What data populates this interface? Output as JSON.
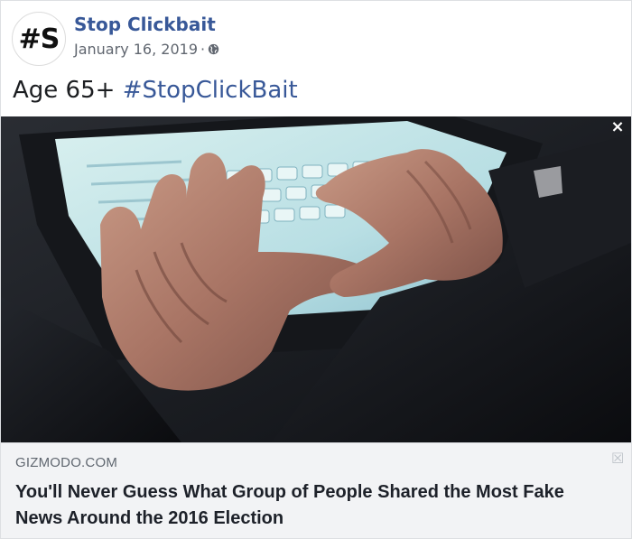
{
  "post": {
    "avatar_text": "#S",
    "page_name": "Stop Clickbait",
    "date": "January 16, 2019",
    "separator": "·",
    "privacy_icon": "globe-icon",
    "text_prefix": "Age 65+",
    "hashtag": "#StopClickBait"
  },
  "image": {
    "close_symbol": "×",
    "close_icon": "close-icon"
  },
  "link": {
    "domain": "GIZMODO.COM",
    "title": "You'll Never Guess What Group of People Shared the Most Fake News Around the 2016 Election",
    "hide_symbol": "☒",
    "hide_icon": "hide-preview-icon"
  },
  "colors": {
    "brand_link": "#385898",
    "meta_text": "#616770",
    "preview_bg": "#f2f3f5"
  }
}
